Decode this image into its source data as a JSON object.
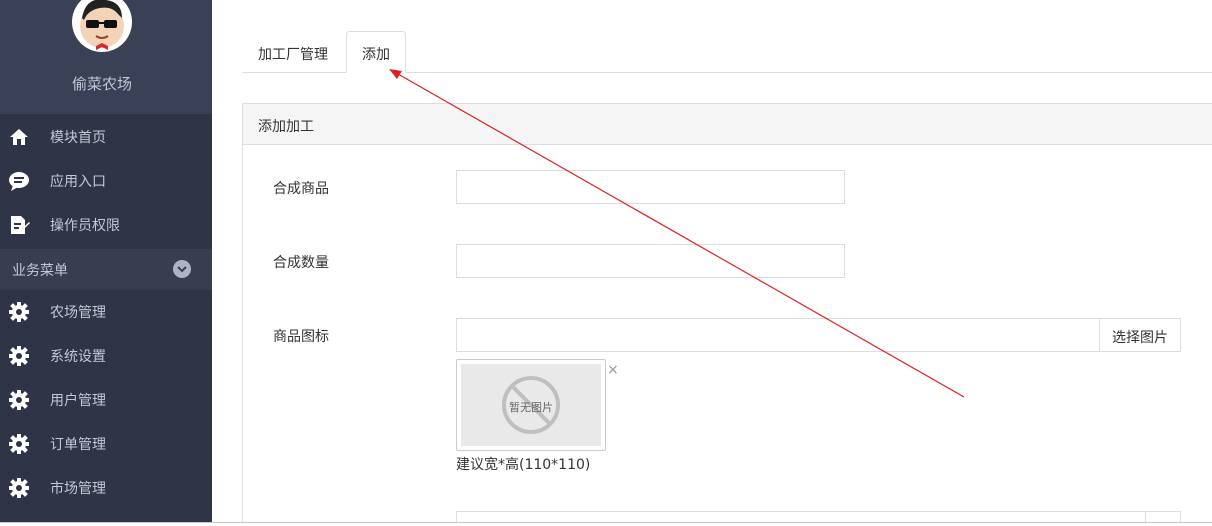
{
  "sidebar": {
    "brand": "偷菜农场",
    "items": [
      {
        "label": "模块首页",
        "icon": "home-icon"
      },
      {
        "label": "应用入口",
        "icon": "chat-bubble-icon"
      },
      {
        "label": "操作员权限",
        "icon": "document-edit-icon"
      }
    ],
    "group_label": "业务菜单",
    "group_items": [
      {
        "label": "农场管理",
        "icon": "gear-icon"
      },
      {
        "label": "系统设置",
        "icon": "gear-icon"
      },
      {
        "label": "用户管理",
        "icon": "gear-icon"
      },
      {
        "label": "订单管理",
        "icon": "gear-icon"
      },
      {
        "label": "市场管理",
        "icon": "gear-icon"
      }
    ]
  },
  "tabs": {
    "manage": "加工厂管理",
    "add": "添加"
  },
  "panel": {
    "title": "添加加工"
  },
  "form": {
    "product_label": "合成商品",
    "quantity_label": "合成数量",
    "icon_label": "商品图标",
    "pick_button": "选择图片",
    "no_image_text": "暂无图片",
    "remove": "×",
    "hint": "建议宽*高(110*110)"
  },
  "colors": {
    "sidebar_bg": "#2f3446",
    "sidebar_text": "#c3c8d6",
    "annotation_arrow": "#e02020"
  }
}
